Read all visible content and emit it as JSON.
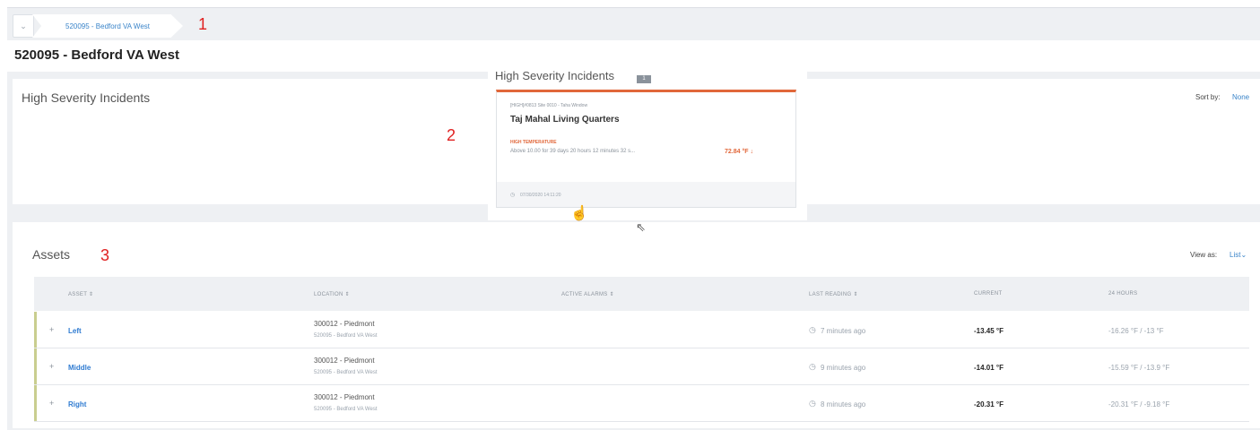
{
  "breadcrumb": {
    "select_arrow": "⌄",
    "item": "520095 - Bedford VA West"
  },
  "annotations": [
    "1",
    "2",
    "3"
  ],
  "page": {
    "title": "520095 - Bedford VA West"
  },
  "high_severity": {
    "title": "High Severity Incidents",
    "sort_label": "Sort by:",
    "sort_value": "None"
  },
  "popup": {
    "title": "High Severity Incidents",
    "badge": "1",
    "incident": {
      "meta": "[HIGH]#0813 Site 0010 - Taha Window",
      "name": "Taj Mahal Living Quarters",
      "type": "HIGH TEMPERATURE",
      "description": "Above 10.00 for 39 days 20 hours 12 minutes 32 s...",
      "value": "72.84 °F",
      "timestamp": "07/30/2020 14:11:20"
    }
  },
  "assets": {
    "title": "Assets",
    "view_label": "View as:",
    "view_value": "List",
    "columns": [
      "ASSET",
      "LOCATION",
      "ACTIVE ALARMS",
      "LAST READING",
      "CURRENT",
      "24 HOURS"
    ],
    "rows": [
      {
        "name": "Left",
        "location": "300012 - Piedmont",
        "location_sub": "520095 - Bedford VA West",
        "last_reading": "7 minutes ago",
        "current": "-13.45 °F",
        "range": "-16.26 °F / -13 °F"
      },
      {
        "name": "Middle",
        "location": "300012 - Piedmont",
        "location_sub": "520095 - Bedford VA West",
        "last_reading": "9 minutes ago",
        "current": "-14.01 °F",
        "range": "-15.59 °F / -13.9 °F"
      },
      {
        "name": "Right",
        "location": "300012 - Piedmont",
        "location_sub": "520095 - Bedford VA West",
        "last_reading": "8 minutes ago",
        "current": "-20.31 °F",
        "range": "-20.31 °F / -9.18 °F"
      }
    ]
  },
  "colors": {
    "accent": "#3a84c9",
    "alert": "#e1673a",
    "annotation": "#e02020",
    "row_accent": "#c9ce8f"
  },
  "icons": {
    "clock": "clock-icon",
    "sort": "sort-icon",
    "expand": "expand-icon",
    "hand_cursor": "hand-cursor-icon",
    "pointer_cursor": "pointer-cursor-icon"
  }
}
